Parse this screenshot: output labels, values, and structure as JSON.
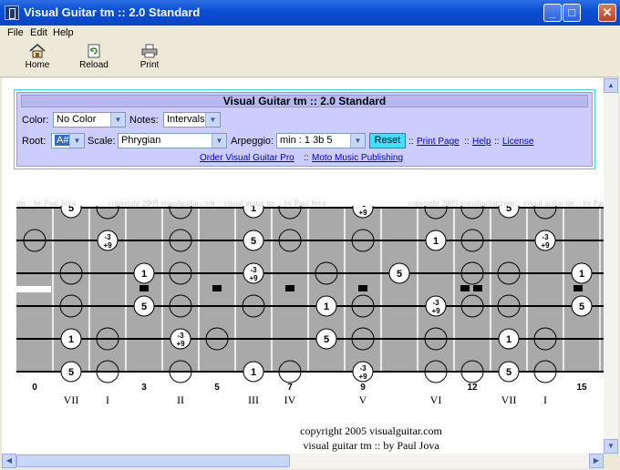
{
  "window": {
    "title": "Visual Guitar tm :: 2.0 Standard",
    "min": "_",
    "max": "□",
    "close": "✕"
  },
  "menu": [
    "File",
    "Edit",
    "Help"
  ],
  "toolbar": [
    {
      "label": "Home",
      "icon": "home-icon"
    },
    {
      "label": "Reload",
      "icon": "reload-icon"
    },
    {
      "label": "Print",
      "icon": "print-icon"
    }
  ],
  "panel": {
    "title": "Visual Guitar tm :: 2.0 Standard",
    "color_label": "Color:",
    "color_value": "No Color",
    "notes_label": "Notes:",
    "notes_value": "Intervals",
    "root_label": "Root:",
    "root_value": "A#",
    "scale_label": "Scale:",
    "scale_value": "Phrygian",
    "arpeggio_label": "Arpeggio:",
    "arpeggio_value": "min : 1 3b 5",
    "reset_label": "Reset",
    "sep": "::",
    "print_link": "Print Page",
    "help_link": "Help",
    "license_link": "License",
    "order_link": "Order Visual Guitar Pro",
    "moto_link": "Moto Music Publishing"
  },
  "watermark": "tm :: by Paul Jova                copyright 2005 visualguitar.com :: visual guitar tm :: by Paul Jova                                        copyright 2005 visualguitar.com :: visual guitar tm :: by Paul Jova",
  "fretboard": {
    "fret_numbers": [
      "0",
      "3",
      "5",
      "7",
      "9",
      "12",
      "15"
    ],
    "numerals": [
      "VII",
      "I",
      "II",
      "III",
      "IV",
      "V",
      "VI",
      "VII",
      "I"
    ],
    "notes": [
      [
        "5",
        "",
        "",
        "",
        "1",
        "",
        "-3\n+9",
        "",
        "",
        "5",
        ""
      ],
      [
        "",
        "-3\n+9",
        "",
        "",
        "5",
        "",
        "",
        "",
        "1",
        "",
        "-3\n+9"
      ],
      [
        "",
        "",
        "1",
        "",
        "-3\n+9",
        "",
        "",
        "5",
        "",
        "",
        "1"
      ],
      [
        "",
        "",
        "5",
        "",
        "",
        "1",
        "",
        "",
        "-3\n+9",
        "",
        "5"
      ],
      [
        "1",
        "",
        "",
        "-3\n+9",
        "",
        "5",
        "",
        "",
        "",
        "1",
        ""
      ],
      [
        "5",
        "",
        "",
        "",
        "1",
        "",
        "-3\n+9",
        "",
        "",
        "5",
        ""
      ]
    ]
  },
  "footer": {
    "line1": "copyright 2005 visualguitar.com",
    "line2": "visual guitar tm :: by Paul Jova"
  }
}
